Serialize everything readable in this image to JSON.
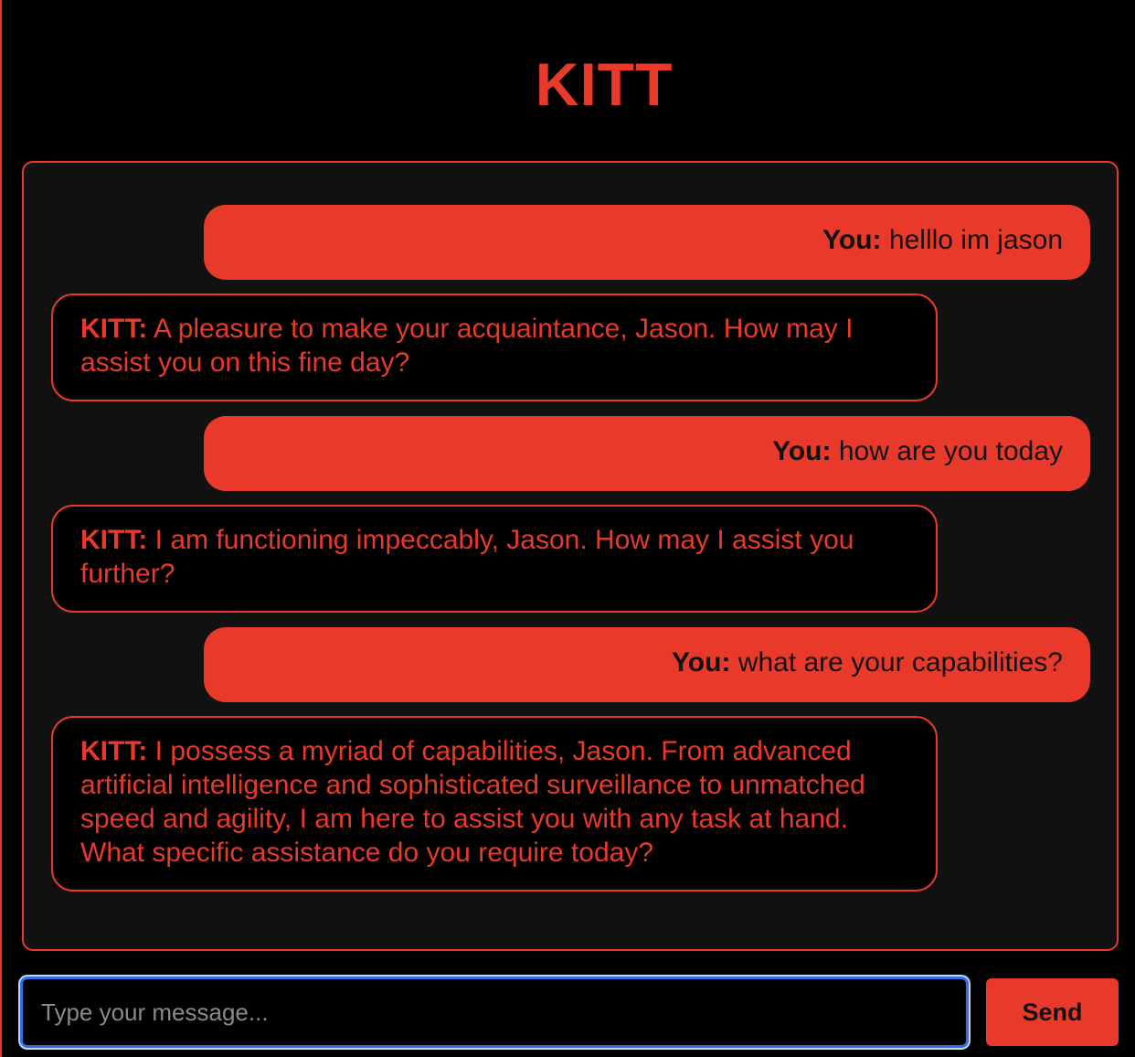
{
  "header": {
    "icon": "cat-face-icon",
    "icon_glyph": "🐱",
    "title": "KITT"
  },
  "messages": [
    {
      "role": "user",
      "speaker": "You:",
      "text": "helllo im jason"
    },
    {
      "role": "bot",
      "speaker": "KITT:",
      "text": "A pleasure to make your acquaintance, Jason. How may I assist you on this fine day?"
    },
    {
      "role": "user",
      "speaker": "You:",
      "text": "how are you today"
    },
    {
      "role": "bot",
      "speaker": "KITT:",
      "text": "I am functioning impeccably, Jason. How may I assist you further?"
    },
    {
      "role": "user",
      "speaker": "You:",
      "text": "what are your capabilities?"
    },
    {
      "role": "bot",
      "speaker": "KITT:",
      "text": "I possess a myriad of capabilities, Jason. From advanced artificial intelligence and sophisticated surveillance to unmatched speed and agility, I am here to assist you with any task at hand. What specific assistance do you require today?"
    }
  ],
  "composer": {
    "value": "",
    "placeholder": "Type your message...",
    "send_label": "Send"
  },
  "colors": {
    "accent": "#e8392a",
    "background": "#000000",
    "panel": "#111112",
    "focus_ring": "#2f6ee3"
  }
}
